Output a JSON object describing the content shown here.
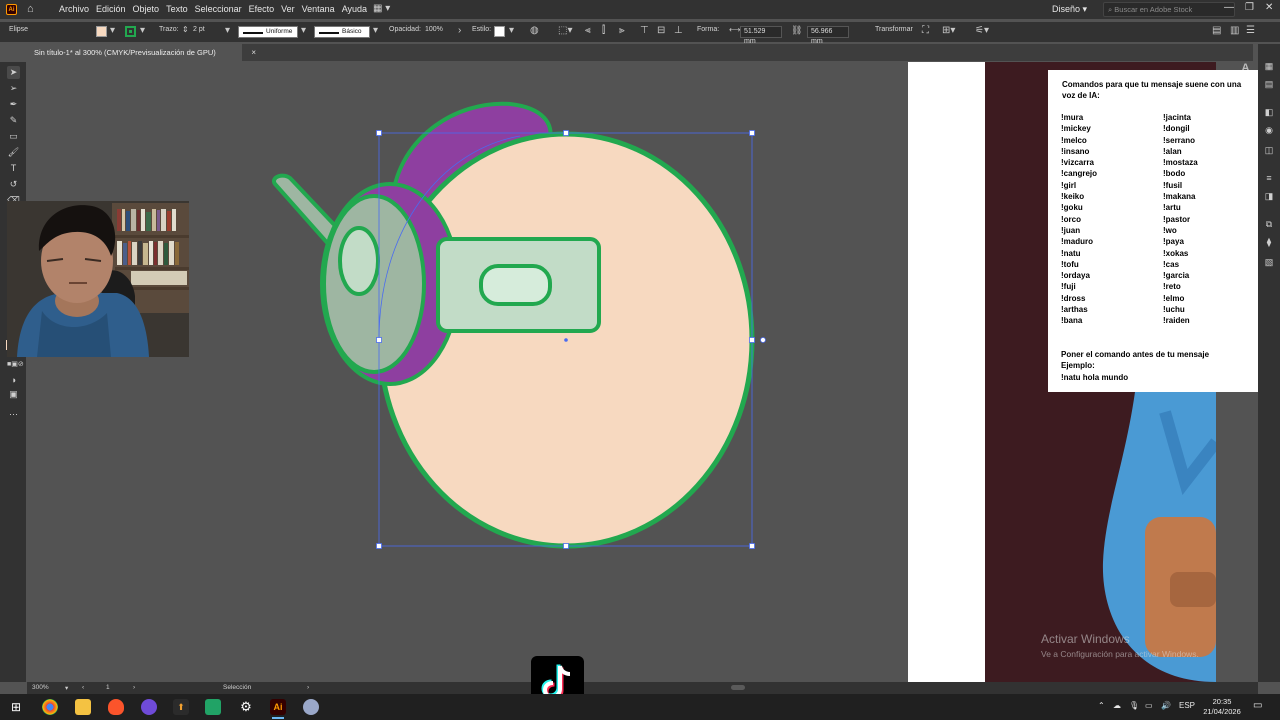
{
  "app": {
    "logo": "Ai",
    "menus": [
      "Archivo",
      "Edición",
      "Objeto",
      "Texto",
      "Seleccionar",
      "Efecto",
      "Ver",
      "Ventana",
      "Ayuda"
    ],
    "workspace": "Diseño",
    "search_placeholder": "Buscar en Adobe Stock"
  },
  "control_bar": {
    "object_type": "Elipse",
    "stroke_label": "Trazo:",
    "stroke_weight": "2 pt",
    "profile": "Uniforme",
    "brush": "Básico",
    "opacity_label": "Opacidad:",
    "opacity_value": "100%",
    "style_label": "Estilo:",
    "shape_label": "Forma:",
    "width_value": "51.529 mm",
    "height_value": "56.966 mm",
    "transform_label": "Transformar",
    "fill_color": "#f7d9c0",
    "stroke_color": "#22a84f"
  },
  "document_tab": {
    "title": "Sin título-1* al 300% (CMYK/Previsualización de GPU)",
    "close": "×"
  },
  "commands_panel": {
    "title": "Comandos para que tu mensaje suene con una voz de IA:",
    "col1": [
      "!mura",
      "!mickey",
      "!melco",
      "!insano",
      "!vizcarra",
      "!cangrejo",
      "!girl",
      "!keiko",
      "!goku",
      "!orco",
      "!juan",
      "!maduro",
      "!natu",
      "!tofu",
      "!ordaya",
      "!fuji",
      "!dross",
      "!arthas",
      "!bana"
    ],
    "col2": [
      "!jacinta",
      "!dongil",
      "!serrano",
      "!alan",
      "!mostaza",
      "!bodo",
      "!fusil",
      "!makana",
      "!artu",
      "!pastor",
      "!wo",
      "!paya",
      "!xokas",
      "!cas",
      "!garcia",
      "!reto",
      "!elmo",
      "!uchu",
      "!raiden"
    ],
    "footer1": "Poner el comando antes de tu mensaje",
    "footer2": "Ejemplo:",
    "footer3": "!natu hola mundo"
  },
  "watermark": {
    "line1": "Activar Windows",
    "line2": "Ve a Configuración para activar Windows."
  },
  "status_bar": {
    "zoom": "300%",
    "artboard": "1",
    "tool": "Selección"
  },
  "taskbar": {
    "language": "ESP",
    "time": "20:35",
    "date": "21/04/2026"
  },
  "colors": {
    "skin": "#f7d9c0",
    "green": "#22a84f",
    "purple": "#8e3fa0",
    "gray_green": "#9eb6a2",
    "light_green": "#c2dcc7",
    "pale_green": "#d6ecdb",
    "selection": "#4a6cf0"
  }
}
